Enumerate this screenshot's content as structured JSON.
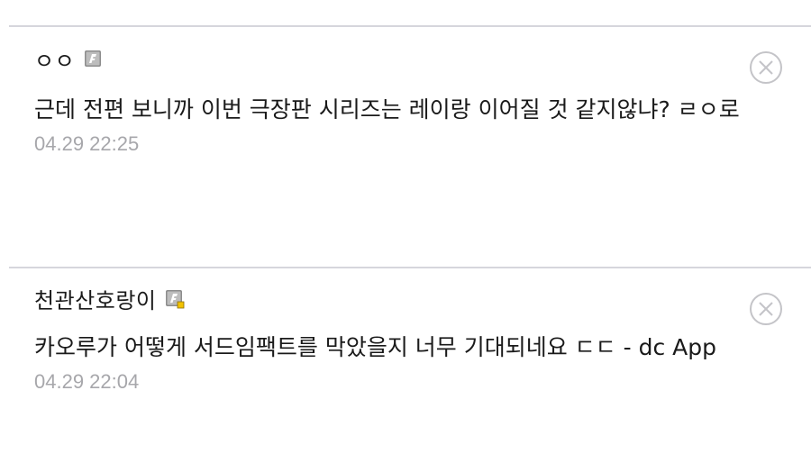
{
  "comments": [
    {
      "nickname": "ㅇㅇ",
      "badge_icon": "gallery-fixed-nick-icon",
      "text": "근데 전편 보니까 이번 극장판 시리즈는 레이랑 이어질 것 같지않냐? ㄹㅇ로",
      "time": "04.29 22:25",
      "delete_icon": "close-circle-icon"
    },
    {
      "nickname": "천관산호랑이",
      "badge_icon": "gallery-manager-nick-icon",
      "text": "카오루가 어떻게 서드임팩트를 막았을지 너무 기대되네요 ㄷㄷ - dc App",
      "time": "04.29 22:04",
      "delete_icon": "close-circle-icon"
    }
  ],
  "colors": {
    "divider": "#d6d6dc",
    "timestamp": "#a7a7ab",
    "text": "#1a1a1a",
    "delete_icon": "#c4c4c8"
  }
}
